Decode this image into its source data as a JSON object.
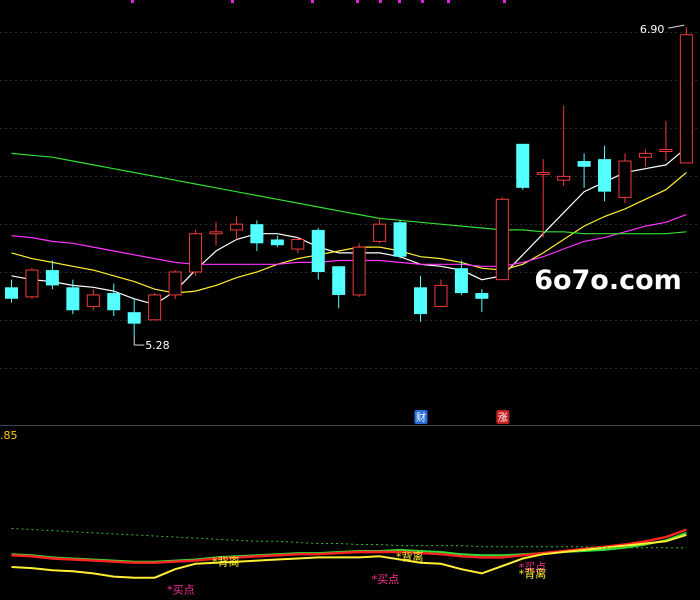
{
  "chart_data": [
    {
      "type": "candlestick",
      "title": "",
      "ylim": [
        4.93,
        7.0
      ],
      "up_color": "#ef3b3b",
      "down_color": "#54ffff",
      "candles": [
        {
          "o": 5.54,
          "h": 5.58,
          "l": 5.46,
          "c": 5.48
        },
        {
          "o": 5.49,
          "h": 5.64,
          "l": 5.48,
          "c": 5.63
        },
        {
          "o": 5.63,
          "h": 5.68,
          "l": 5.53,
          "c": 5.55
        },
        {
          "o": 5.54,
          "h": 5.58,
          "l": 5.4,
          "c": 5.42
        },
        {
          "o": 5.44,
          "h": 5.53,
          "l": 5.42,
          "c": 5.5
        },
        {
          "o": 5.51,
          "h": 5.56,
          "l": 5.39,
          "c": 5.42
        },
        {
          "o": 5.41,
          "h": 5.48,
          "l": 5.28,
          "c": 5.35
        },
        {
          "o": 5.37,
          "h": 5.51,
          "l": 5.37,
          "c": 5.5
        },
        {
          "o": 5.5,
          "h": 5.63,
          "l": 5.48,
          "c": 5.62
        },
        {
          "o": 5.62,
          "h": 5.84,
          "l": 5.6,
          "c": 5.82
        },
        {
          "o": 5.82,
          "h": 5.88,
          "l": 5.76,
          "c": 5.83
        },
        {
          "o": 5.84,
          "h": 5.91,
          "l": 5.79,
          "c": 5.87
        },
        {
          "o": 5.87,
          "h": 5.89,
          "l": 5.73,
          "c": 5.77
        },
        {
          "o": 5.79,
          "h": 5.81,
          "l": 5.75,
          "c": 5.76
        },
        {
          "o": 5.74,
          "h": 5.8,
          "l": 5.72,
          "c": 5.79
        },
        {
          "o": 5.84,
          "h": 5.85,
          "l": 5.58,
          "c": 5.62
        },
        {
          "o": 5.65,
          "h": 5.65,
          "l": 5.43,
          "c": 5.5
        },
        {
          "o": 5.5,
          "h": 5.77,
          "l": 5.49,
          "c": 5.75
        },
        {
          "o": 5.78,
          "h": 5.9,
          "l": 5.77,
          "c": 5.87
        },
        {
          "o": 5.88,
          "h": 5.89,
          "l": 5.69,
          "c": 5.7
        },
        {
          "o": 5.54,
          "h": 5.6,
          "l": 5.36,
          "c": 5.4
        },
        {
          "o": 5.44,
          "h": 5.58,
          "l": 5.44,
          "c": 5.55
        },
        {
          "o": 5.64,
          "h": 5.68,
          "l": 5.5,
          "c": 5.51
        },
        {
          "o": 5.51,
          "h": 5.53,
          "l": 5.41,
          "c": 5.48
        },
        {
          "o": 5.58,
          "h": 6.01,
          "l": 5.58,
          "c": 6.0
        },
        {
          "o": 6.29,
          "h": 6.29,
          "l": 6.05,
          "c": 6.06
        },
        {
          "o": 6.13,
          "h": 6.21,
          "l": 5.8,
          "c": 6.14
        },
        {
          "o": 6.1,
          "h": 6.49,
          "l": 6.07,
          "c": 6.12
        },
        {
          "o": 6.2,
          "h": 6.24,
          "l": 6.06,
          "c": 6.17
        },
        {
          "o": 6.21,
          "h": 6.28,
          "l": 5.99,
          "c": 6.04
        },
        {
          "o": 6.01,
          "h": 6.24,
          "l": 5.98,
          "c": 6.2
        },
        {
          "o": 6.22,
          "h": 6.26,
          "l": 6.17,
          "c": 6.24
        },
        {
          "o": 6.25,
          "h": 6.41,
          "l": 6.2,
          "c": 6.26
        },
        {
          "o": 6.19,
          "h": 6.9,
          "l": 6.19,
          "c": 6.86
        }
      ],
      "ma_lines": [
        {
          "color": "#ffffff",
          "values": [
            5.6,
            5.58,
            5.57,
            5.55,
            5.54,
            5.52,
            5.48,
            5.45,
            5.52,
            5.63,
            5.73,
            5.79,
            5.82,
            5.82,
            5.8,
            5.75,
            5.72,
            5.72,
            5.72,
            5.7,
            5.66,
            5.65,
            5.63,
            5.58,
            5.6,
            5.71,
            5.82,
            5.93,
            6.04,
            6.09,
            6.14,
            6.16,
            6.18,
            6.27
          ]
        },
        {
          "color": "#ffee33",
          "values": [
            5.72,
            5.69,
            5.67,
            5.65,
            5.63,
            5.6,
            5.57,
            5.53,
            5.51,
            5.52,
            5.55,
            5.59,
            5.62,
            5.66,
            5.69,
            5.71,
            5.73,
            5.75,
            5.75,
            5.73,
            5.7,
            5.69,
            5.67,
            5.64,
            5.63,
            5.66,
            5.72,
            5.79,
            5.86,
            5.91,
            5.95,
            6.0,
            6.05,
            6.14
          ]
        },
        {
          "color": "#ff33ff",
          "values": [
            5.81,
            5.8,
            5.78,
            5.77,
            5.75,
            5.73,
            5.71,
            5.69,
            5.67,
            5.66,
            5.66,
            5.66,
            5.66,
            5.66,
            5.67,
            5.67,
            5.68,
            5.68,
            5.68,
            5.67,
            5.66,
            5.66,
            5.66,
            5.65,
            5.65,
            5.67,
            5.7,
            5.74,
            5.78,
            5.8,
            5.83,
            5.86,
            5.88,
            5.92
          ]
        },
        {
          "color": "#33dd33",
          "values": [
            6.24,
            6.23,
            6.22,
            6.2,
            6.18,
            6.16,
            6.14,
            6.12,
            6.1,
            6.08,
            6.06,
            6.04,
            6.02,
            6.0,
            5.98,
            5.96,
            5.94,
            5.92,
            5.9,
            5.89,
            5.88,
            5.87,
            5.86,
            5.85,
            5.84,
            5.84,
            5.83,
            5.83,
            5.82,
            5.82,
            5.82,
            5.82,
            5.82,
            5.83
          ]
        }
      ],
      "labels": [
        {
          "text": "6.90",
          "index": 33,
          "value": 6.9,
          "anchor": "end",
          "color": "#ffffff"
        },
        {
          "text": "5.28",
          "index": 6,
          "value": 5.28,
          "anchor": "start",
          "color": "#ffffff"
        }
      ],
      "event_badges": [
        {
          "text": "财",
          "index": 20,
          "color": "#2a6fd6"
        },
        {
          "text": "涨",
          "index": 24,
          "color": "#c02020"
        }
      ],
      "watermark": "6o7o.com"
    },
    {
      "type": "line",
      "title": "",
      "axis_value": ".85",
      "axis_value_color": "#ffcc00",
      "ylim": [
        0,
        1
      ],
      "series": [
        {
          "color": "#33dd33",
          "style": "solid",
          "width": 2,
          "values": [
            0.26,
            0.25,
            0.23,
            0.22,
            0.21,
            0.2,
            0.19,
            0.19,
            0.2,
            0.21,
            0.23,
            0.24,
            0.25,
            0.26,
            0.27,
            0.27,
            0.28,
            0.29,
            0.29,
            0.3,
            0.29,
            0.28,
            0.26,
            0.25,
            0.25,
            0.26,
            0.27,
            0.28,
            0.29,
            0.3,
            0.32,
            0.35,
            0.39,
            0.46
          ]
        },
        {
          "color": "#ff2222",
          "style": "solid",
          "width": 2.4,
          "values": [
            0.25,
            0.24,
            0.22,
            0.21,
            0.2,
            0.19,
            0.18,
            0.18,
            0.19,
            0.2,
            0.22,
            0.23,
            0.24,
            0.25,
            0.26,
            0.26,
            0.27,
            0.28,
            0.28,
            0.28,
            0.27,
            0.26,
            0.24,
            0.23,
            0.23,
            0.25,
            0.27,
            0.29,
            0.31,
            0.33,
            0.35,
            0.38,
            0.42,
            0.49
          ]
        },
        {
          "color": "#ffee33",
          "style": "solid",
          "width": 2,
          "values": [
            0.14,
            0.13,
            0.11,
            0.1,
            0.08,
            0.05,
            0.04,
            0.04,
            0.12,
            0.17,
            0.18,
            0.19,
            0.2,
            0.21,
            0.22,
            0.23,
            0.23,
            0.23,
            0.24,
            0.21,
            0.18,
            0.17,
            0.12,
            0.08,
            0.15,
            0.22,
            0.26,
            0.28,
            0.3,
            0.32,
            0.34,
            0.36,
            0.38,
            0.44
          ]
        },
        {
          "color": "#33bb33",
          "style": "dashed",
          "width": 1,
          "values": [
            0.5,
            0.49,
            0.48,
            0.47,
            0.46,
            0.45,
            0.44,
            0.43,
            0.42,
            0.41,
            0.4,
            0.39,
            0.38,
            0.38,
            0.37,
            0.36,
            0.36,
            0.35,
            0.35,
            0.34,
            0.34,
            0.34,
            0.34,
            0.33,
            0.33,
            0.33,
            0.33,
            0.33,
            0.33,
            0.32,
            0.32,
            0.32,
            0.32,
            0.32
          ]
        }
      ],
      "signals": [
        {
          "text": "*买点",
          "index": 8,
          "value": 0.04,
          "position": "below",
          "color": "#ff3399"
        },
        {
          "text": "*背离",
          "index": 10,
          "value": 0.19,
          "position": "right",
          "color": "#ffee33"
        },
        {
          "text": "*买点",
          "index": 18,
          "value": 0.14,
          "position": "below",
          "color": "#ff3399"
        },
        {
          "text": "*背离",
          "index": 19,
          "value": 0.24,
          "position": "right",
          "color": "#ffee33"
        },
        {
          "text": "*买点",
          "index": 25,
          "value": 0.14,
          "position": "right",
          "color": "#ff3399"
        },
        {
          "text": "*背离",
          "index": 25,
          "value": 0.08,
          "position": "right",
          "color": "#ffee33"
        }
      ]
    }
  ]
}
